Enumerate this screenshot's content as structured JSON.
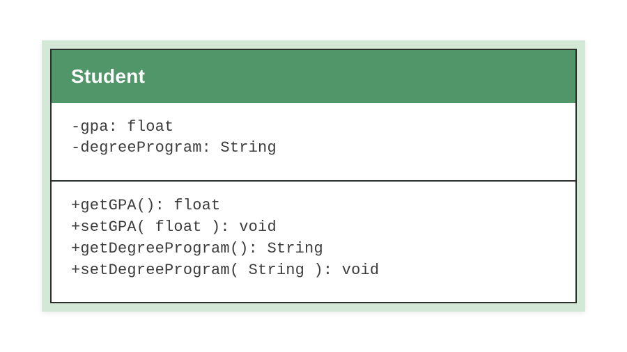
{
  "uml_class": {
    "name": "Student",
    "attributes": [
      {
        "visibility": "-",
        "name": "gpa",
        "type": "float"
      },
      {
        "visibility": "-",
        "name": "degreeProgram",
        "type": "String"
      }
    ],
    "methods": [
      {
        "visibility": "+",
        "name": "getGPA",
        "params": "",
        "return": "float"
      },
      {
        "visibility": "+",
        "name": "setGPA",
        "params": " float ",
        "return": "void"
      },
      {
        "visibility": "+",
        "name": "getDegreeProgram",
        "params": "",
        "return": "String"
      },
      {
        "visibility": "+",
        "name": "setDegreeProgram",
        "params": " String ",
        "return": "void"
      }
    ]
  }
}
